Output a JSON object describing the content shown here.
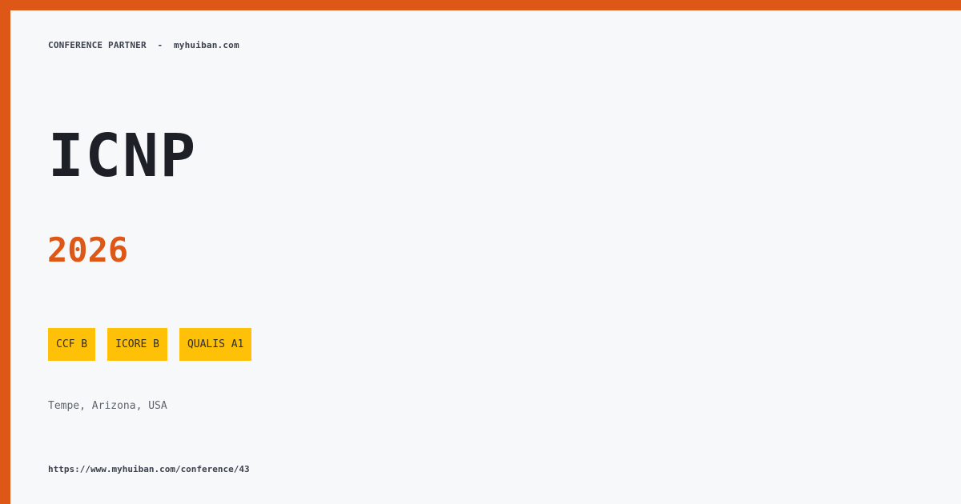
{
  "header": {
    "label": "CONFERENCE PARTNER",
    "separator": "-",
    "site": "myhuiban.com"
  },
  "conference": {
    "acronym": "ICNP",
    "year": "2026",
    "location": "Tempe, Arizona, USA",
    "url": "https://www.myhuiban.com/conference/43"
  },
  "badges": [
    "CCF B",
    "ICORE B",
    "QUALIS A1"
  ],
  "colors": {
    "accent": "#dd5717",
    "badge_bg": "#ffc107",
    "background": "#f7f8fa",
    "title_text": "#1d2127"
  }
}
